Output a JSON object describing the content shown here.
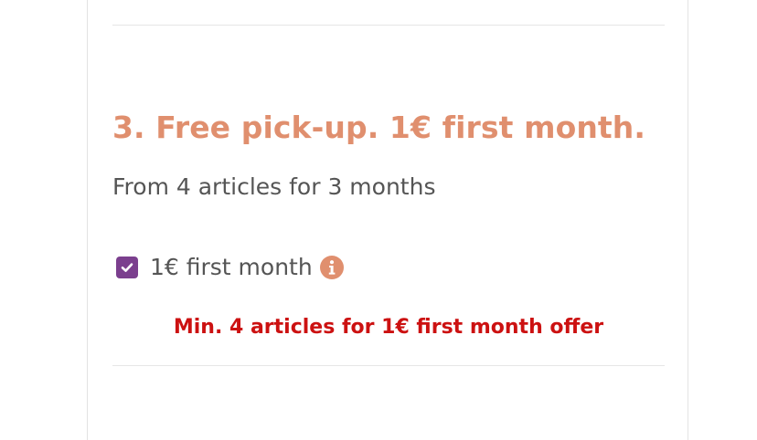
{
  "section": {
    "title": "3. Free pick-up. 1€ first month.",
    "subtitle": "From 4 articles for 3 months",
    "option": {
      "label": "1€ first month",
      "checked": true,
      "icon": "info-icon"
    },
    "warning": "Min. 4 articles for 1€ first month offer"
  },
  "colors": {
    "title": "#e08f6e",
    "checkbox": "#7b3f8e",
    "warning": "#cc1111",
    "info_icon": "#e08f6e"
  }
}
